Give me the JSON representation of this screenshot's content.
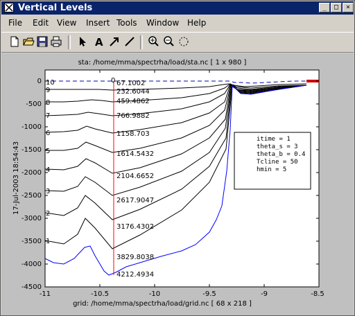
{
  "window": {
    "title": "Vertical Levels",
    "minimize_glyph": "_",
    "maximize_glyph": "□",
    "close_glyph": "×"
  },
  "menu": [
    "File",
    "Edit",
    "View",
    "Insert",
    "Tools",
    "Window",
    "Help"
  ],
  "toolbar_icons": [
    "new-file-icon",
    "open-folder-icon",
    "save-icon",
    "print-icon",
    "select-arrow-icon",
    "insert-text-icon",
    "insert-arrow-icon",
    "insert-line-icon",
    "zoom-in-icon",
    "zoom-out-icon",
    "rotate-icon"
  ],
  "plot": {
    "title": "sta: /home/mma/spectrha/load/sta.nc [ 1 x 980 ]",
    "xlabel": "grid: /home/mma/spectrha/load/grid.nc [ 68 x 218 ]",
    "ylabel": "17-Jul-2003 18:54:43",
    "xticks": [
      "-11",
      "-10.5",
      "-10",
      "-9.5",
      "-9",
      "-8.5"
    ],
    "yticks": [
      "0",
      "-500",
      "-1000",
      "-1500",
      "-2000",
      "-2500",
      "-3000",
      "-3500",
      "-4000",
      "-4500"
    ],
    "infobox": [
      "itime    = 1",
      "theta_s  = 3",
      "theta_b  = 0.4",
      "Tcline   = 50",
      "hmin     = 5"
    ],
    "level_labels": [
      "67.1002",
      "232.6044",
      "459.4862",
      "766.9882",
      "1158.703",
      "1614.5432",
      "2104.6652",
      "2617.9047",
      "3176.4302",
      "3829.8038",
      "4212.4934"
    ],
    "edge_labels": [
      "10",
      "9",
      "8",
      "7",
      "6",
      "5",
      "4",
      "3",
      "2",
      "1",
      "0"
    ],
    "zero_label": "0"
  },
  "chart_data": {
    "type": "line",
    "title": "sta: /home/mma/spectrha/load/sta.nc [ 1 x 980 ]",
    "xlabel": "grid: /home/mma/spectrha/load/grid.nc [ 68 x 218 ]",
    "ylabel": "17-Jul-2003 18:54:43",
    "xlim": [
      -11,
      -8.5
    ],
    "ylim": [
      -4500,
      200
    ],
    "grid": false,
    "colors": {
      "levels": "#000000",
      "bottom": "#0000ff",
      "section": "#ff0000",
      "surface": "#0000aa"
    },
    "section_x": -10.43,
    "bottom_x": [
      -11,
      -10.9,
      -10.8,
      -10.7,
      -10.6,
      -10.55,
      -10.5,
      -10.45,
      -10.43,
      -10.4,
      -10.35,
      -10.3,
      -10.2,
      -10.1,
      -10.0,
      -9.9,
      -9.8,
      -9.7,
      -9.6,
      -9.5,
      -9.45,
      -9.4,
      -9.35,
      -9.33
    ],
    "bottom_y": [
      -3750,
      -3950,
      -3920,
      -3800,
      -3600,
      -3550,
      -3800,
      -4150,
      -4212,
      -4150,
      -4050,
      -3950,
      -3850,
      -3700,
      -3650,
      -3500,
      -3400,
      -3250,
      -2950,
      -2550,
      -2250,
      -1700,
      -800,
      -50
    ]
  }
}
